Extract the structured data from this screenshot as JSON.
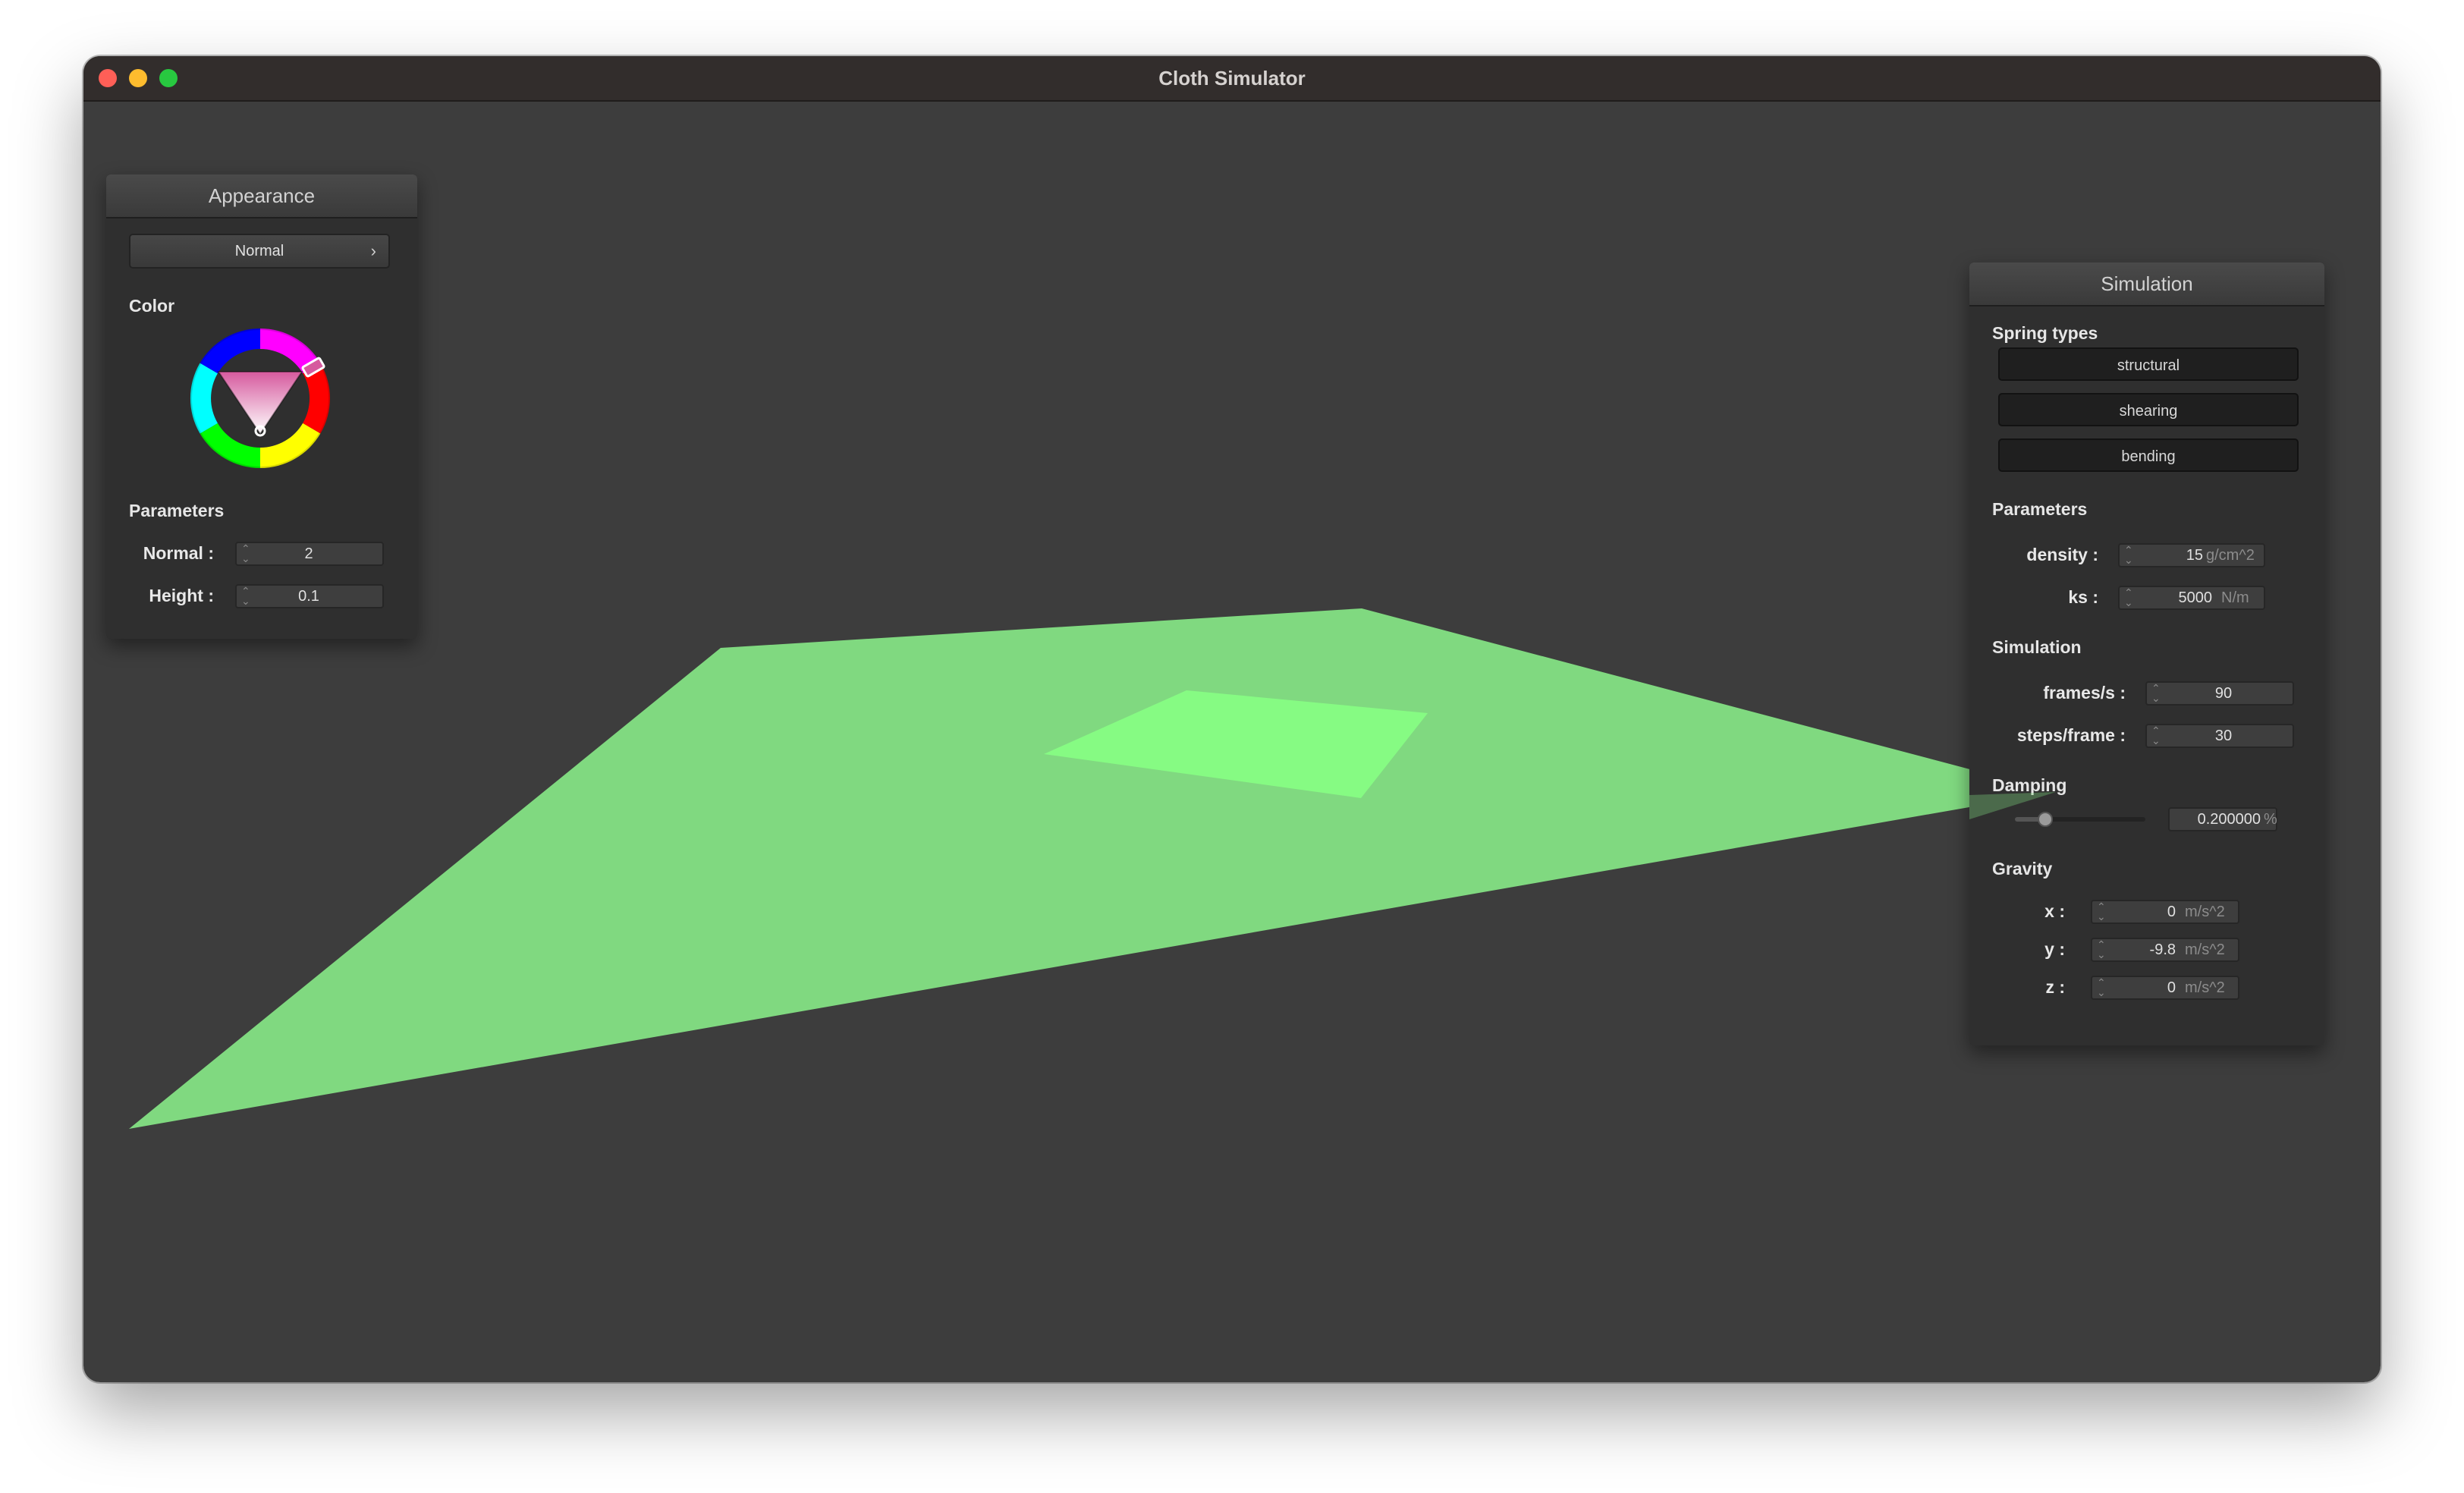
{
  "window": {
    "title": "Cloth Simulator"
  },
  "appearance": {
    "title": "Appearance",
    "shader": "Normal",
    "color_label": "Color",
    "color_hex": "#d65a9e",
    "parameters_label": "Parameters",
    "normal_label": "Normal :",
    "normal_value": "2",
    "height_label": "Height :",
    "height_value": "0.1"
  },
  "simulation": {
    "title": "Simulation",
    "spring_types_label": "Spring types",
    "spring_types": [
      "structural",
      "shearing",
      "bending"
    ],
    "parameters_label": "Parameters",
    "density_label": "density :",
    "density_value": "15",
    "density_unit": "g/cm^2",
    "ks_label": "ks :",
    "ks_value": "5000",
    "ks_unit": "N/m",
    "sim_label": "Simulation",
    "fps_label": "frames/s :",
    "fps_value": "90",
    "steps_label": "steps/frame :",
    "steps_value": "30",
    "damping_label": "Damping",
    "damping_value": "0.200000",
    "damping_unit": "%",
    "damping_fraction": 0.2,
    "gravity_label": "Gravity",
    "x_label": "x :",
    "x_value": "0",
    "y_label": "y :",
    "y_value": "-9.8",
    "z_label": "z :",
    "z_value": "0",
    "gravity_unit": "m/s^2"
  },
  "colors": {
    "cloth": "#80d980",
    "cloth_highlight": "#86fb83",
    "viewport_bg": "#3d3d3d"
  }
}
